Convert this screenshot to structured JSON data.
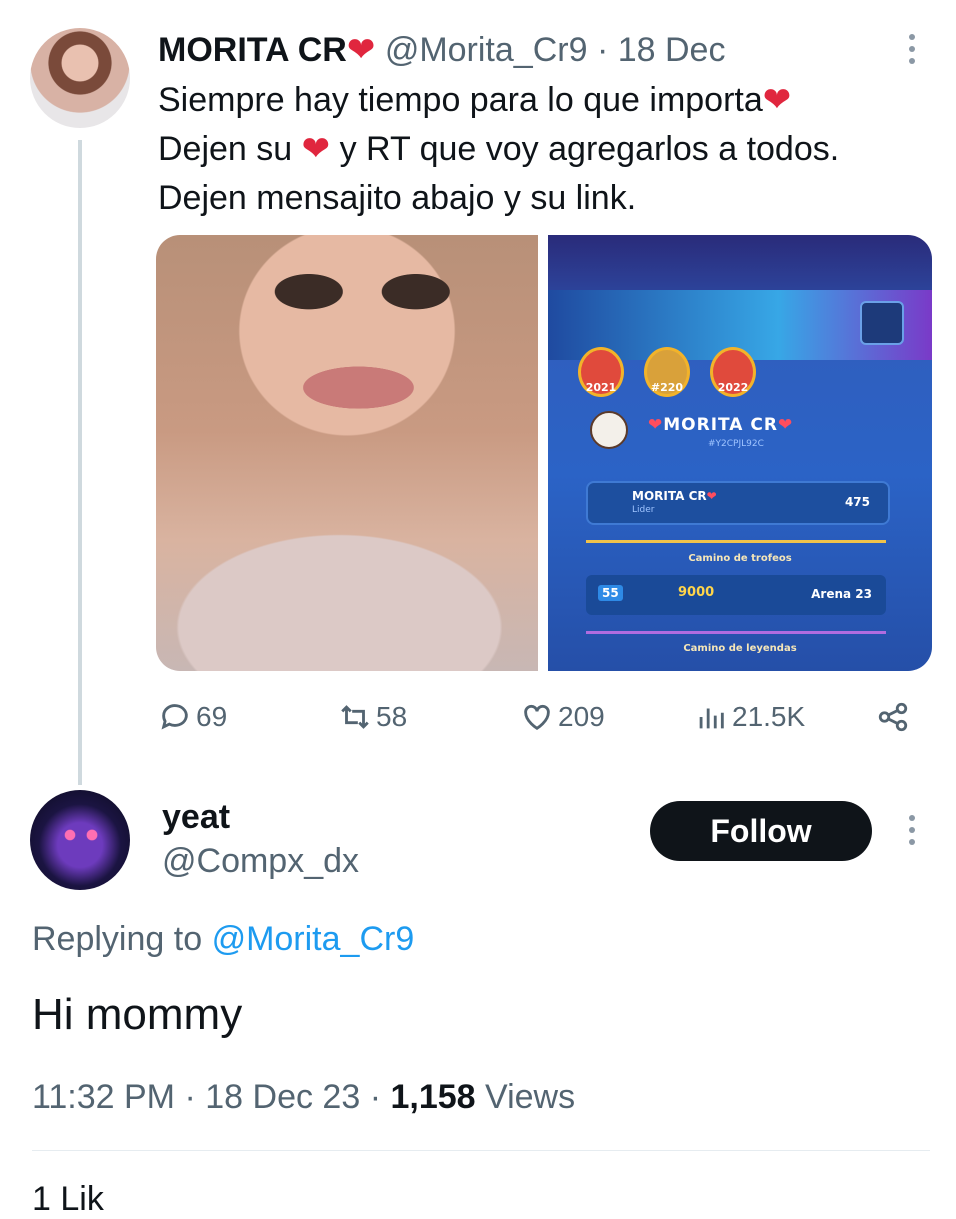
{
  "tweet": {
    "display_name": "MORITA CR",
    "handle": "@Morita_Cr9",
    "date": "18 Dec",
    "lines": [
      "Siempre hay tiempo para lo que importa",
      "Dejen su",
      "y RT que voy agregarlos a todos.",
      "Dejen mensajito abajo y su link."
    ],
    "stats": {
      "replies": "69",
      "retweets": "58",
      "likes": "209",
      "views": "21.5K"
    }
  },
  "game_card": {
    "badges": [
      "2021",
      "#220",
      "2022"
    ],
    "player_name": "MORITA CR",
    "player_tag": "#Y2CPJL92C",
    "clan_name": "MORITA CR",
    "clan_role": "Lider",
    "clan_trophies": "475",
    "trophy_road_label": "Camino de trofeos",
    "level": "55",
    "trophies": "9000",
    "arena": "Arena 23",
    "legend_road_label": "Camino de leyendas"
  },
  "reply": {
    "display_name": "yeat",
    "handle": "@Compx_dx",
    "follow_label": "Follow",
    "replying_prefix": "Replying to",
    "replying_to": "@Morita_Cr9",
    "text": "Hi mommy",
    "time": "11:32 PM",
    "date": "18 Dec 23",
    "views_count": "1,158",
    "views_label": "Views",
    "next_stat": "1 Lik"
  },
  "colors": {
    "text": "#0f1419",
    "secondary": "#536471",
    "link": "#1d9bf0",
    "heart": "#e0263e",
    "button": "#0f1419"
  }
}
